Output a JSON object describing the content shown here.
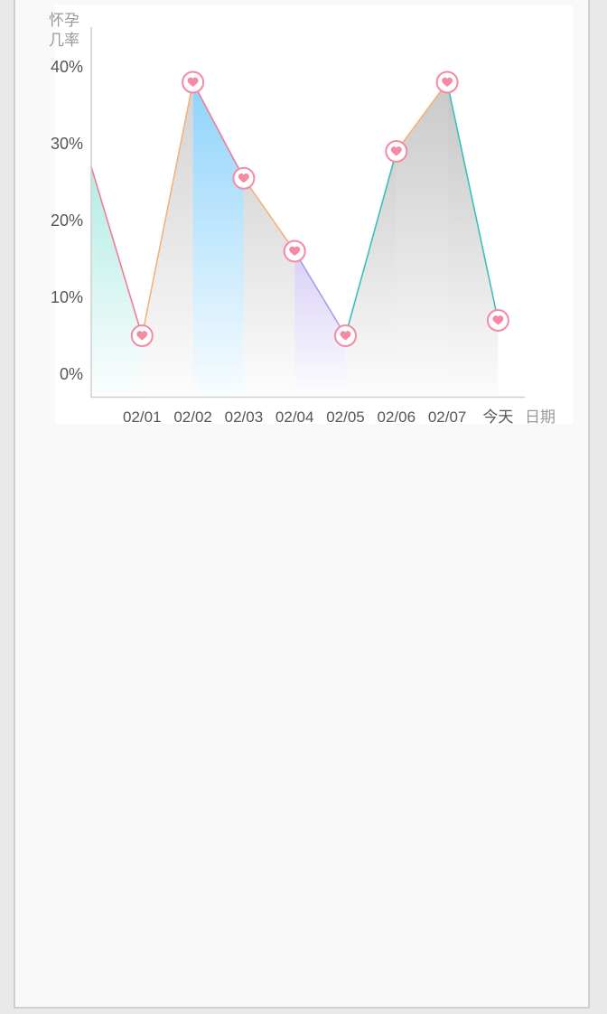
{
  "chart_data": {
    "type": "area",
    "ylabel_lines": [
      "怀孕",
      "几率"
    ],
    "xlabel": "日期",
    "categories": [
      "",
      "02/01",
      "02/02",
      "02/03",
      "02/04",
      "02/05",
      "02/06",
      "02/07",
      "今天"
    ],
    "values": [
      27,
      5,
      38,
      25.5,
      16,
      5,
      29,
      38,
      7
    ],
    "ylim": [
      0,
      40
    ],
    "yticks": [
      "0%",
      "10%",
      "20%",
      "30%",
      "40%"
    ],
    "grid": false,
    "segment_fill_colors": [
      "#b3ece6",
      "#d2d2d2",
      "#8ed3fb",
      "#d9d9d9",
      "#d8cff5",
      "#d0d0d0",
      "#c9c9c9",
      "#c5c5c5"
    ],
    "segment_line_colors": [
      "#f07d95",
      "#f5b27a",
      "#f07d95",
      "#f5b27a",
      "#a99ce8",
      "#3bbfbf",
      "#f5b27a",
      "#3bbfbf"
    ],
    "marker_color": "#f48ba2",
    "marker_icon": "heart-icon"
  }
}
